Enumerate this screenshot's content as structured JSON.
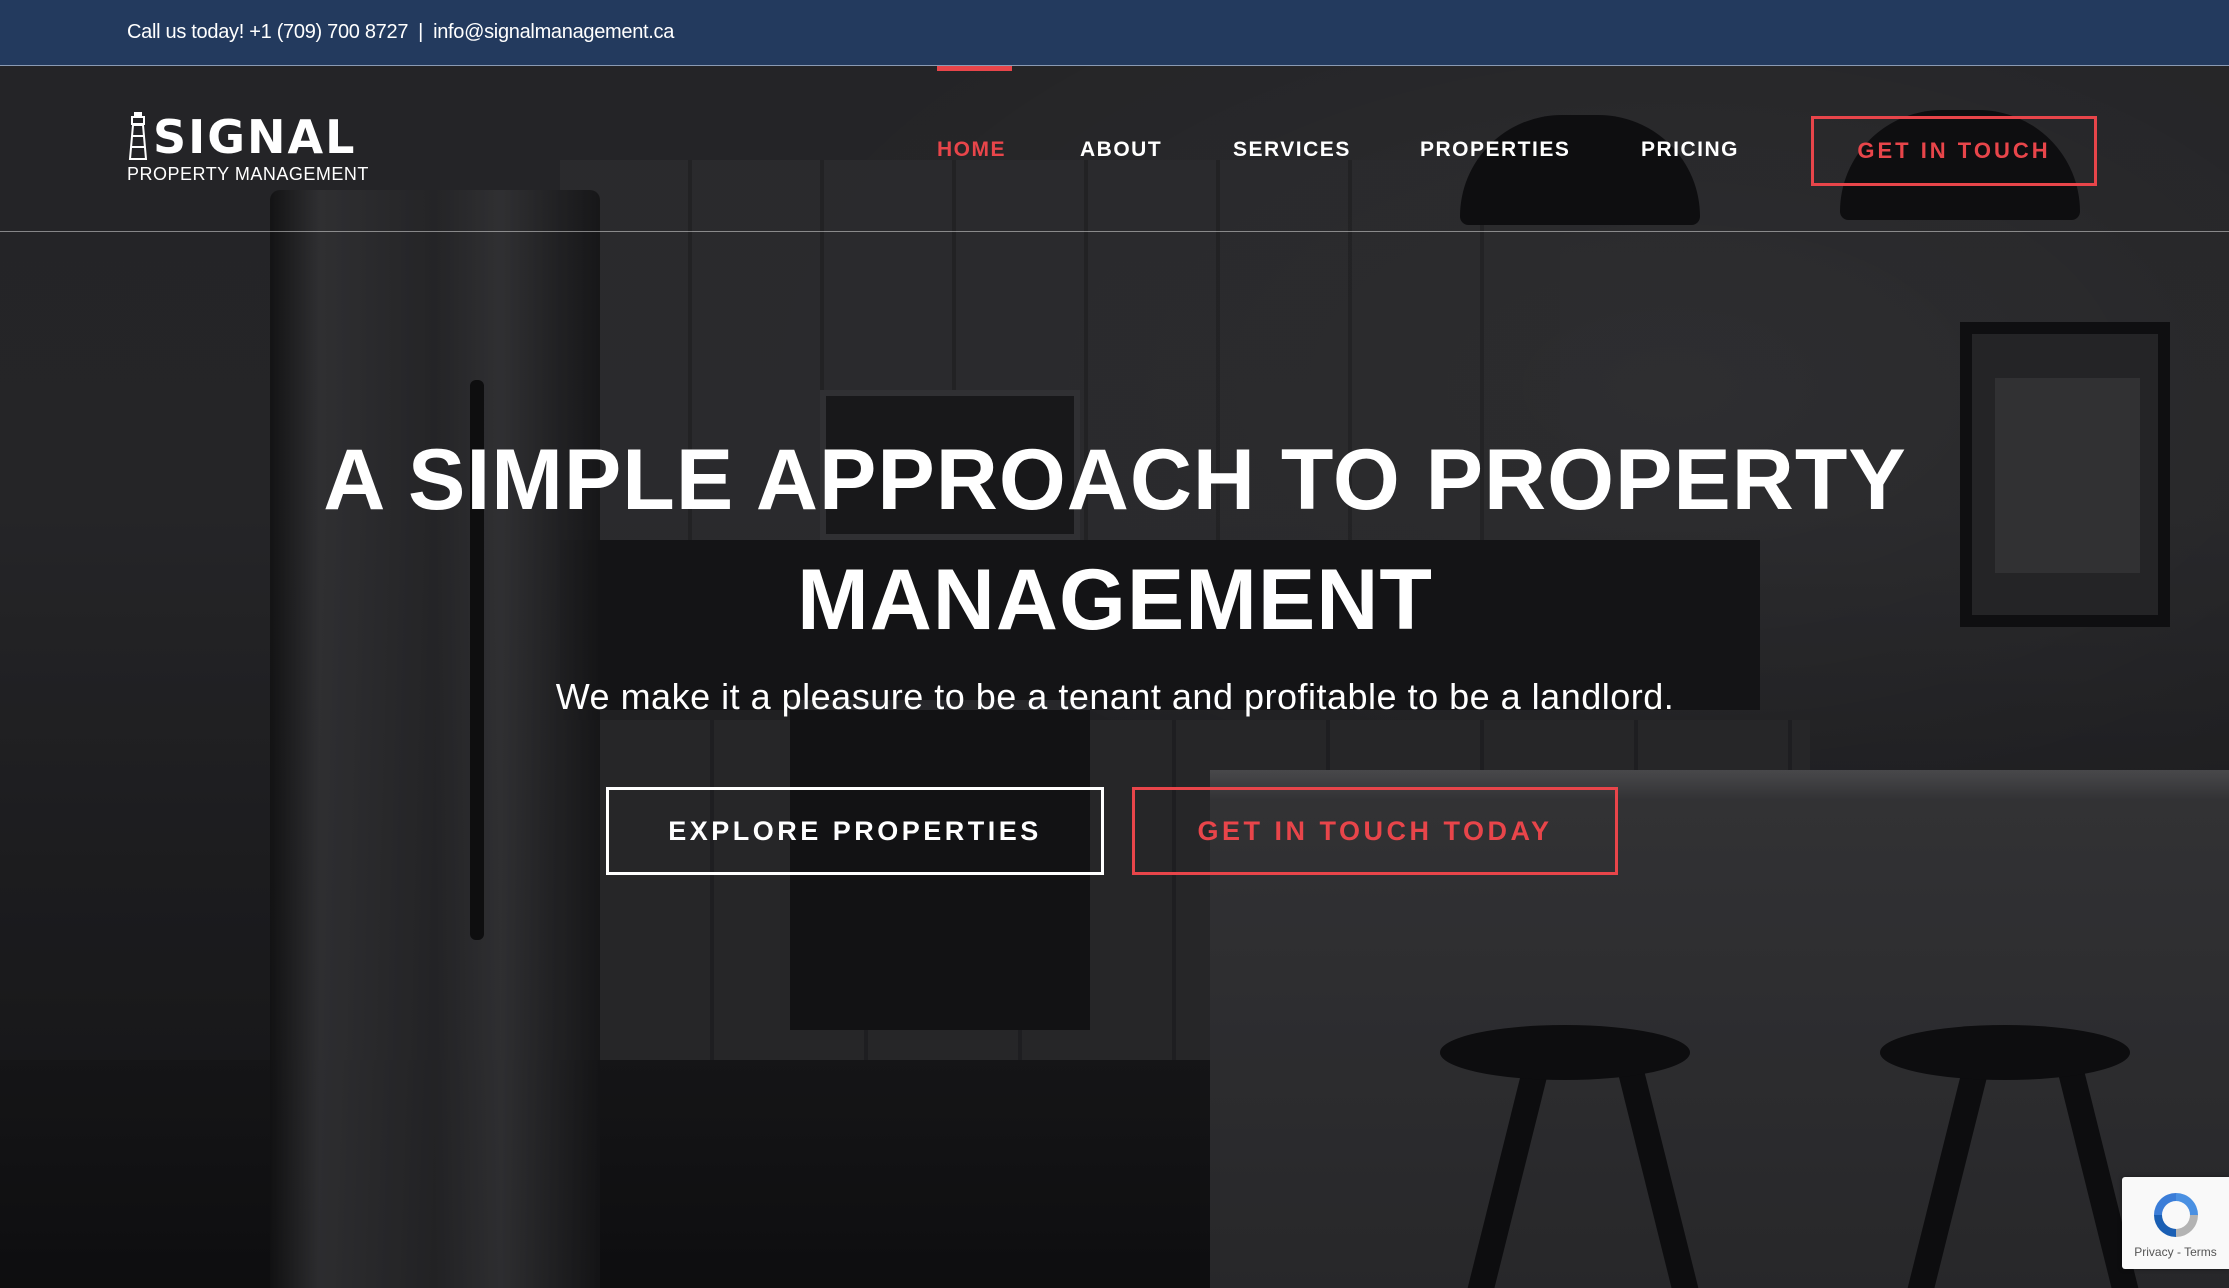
{
  "topbar": {
    "phone_text": "Call us today! +1 (709) 700 8727",
    "separator": "|",
    "email": "info@signalmanagement.ca"
  },
  "logo": {
    "word": "SIGNAL",
    "subtitle": "PROPERTY MANAGEMENT"
  },
  "nav": {
    "items": [
      {
        "label": "HOME",
        "active": true
      },
      {
        "label": "ABOUT",
        "active": false
      },
      {
        "label": "SERVICES",
        "active": false
      },
      {
        "label": "PROPERTIES",
        "active": false
      },
      {
        "label": "PRICING",
        "active": false
      }
    ],
    "cta_label": "GET IN TOUCH"
  },
  "hero": {
    "title_line1": "A SIMPLE APPROACH TO PROPERTY",
    "title_line2": "MANAGEMENT",
    "subtitle": "We make it a pleasure to be a tenant and profitable to be a landlord.",
    "button_explore": "EXPLORE PROPERTIES",
    "button_touch": "GET IN TOUCH TODAY"
  },
  "recaptcha": {
    "privacy": "Privacy",
    "dash": " - ",
    "terms": "Terms"
  },
  "colors": {
    "topbar_bg": "#233a5e",
    "accent": "#e8454a",
    "text": "#ffffff"
  }
}
